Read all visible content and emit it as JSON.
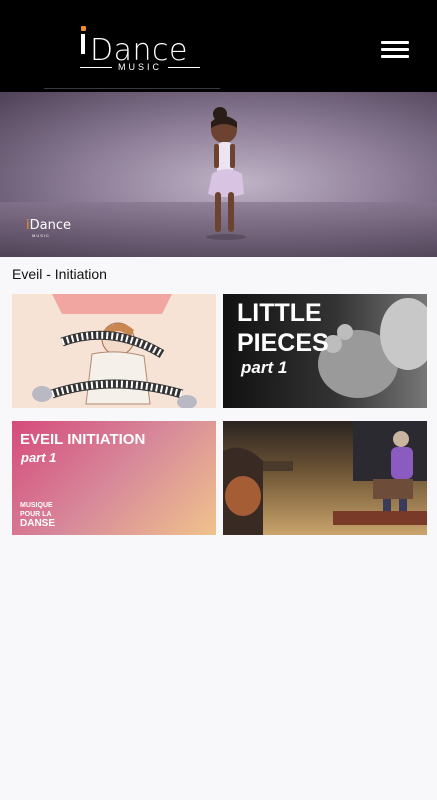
{
  "header": {
    "logo": {
      "text": "Dance",
      "subtitle": "MUSIC"
    },
    "menu_icon": "hamburger-menu-icon"
  },
  "hero": {
    "logo": {
      "brand_i": "i",
      "brand_rest": "Dance",
      "sub": "MUSIC"
    }
  },
  "section": {
    "title": "Eveil - Initiation"
  },
  "cards": [
    {
      "id": "piano",
      "title": ""
    },
    {
      "id": "little-pieces",
      "title_line1": "LITTLE",
      "title_line2": "PIECES",
      "part": "part 1"
    },
    {
      "id": "eveil-initiation",
      "title": "EVEIL INITIATION",
      "part": "part 1",
      "brand_line1": "MUSIQUE",
      "brand_line2": "POUR LA",
      "brand_line3": "DANSE"
    },
    {
      "id": "live-music",
      "title": ""
    }
  ],
  "colors": {
    "accent": "#f28c28",
    "header_bg": "#000000",
    "page_bg": "#f8f8fa"
  }
}
